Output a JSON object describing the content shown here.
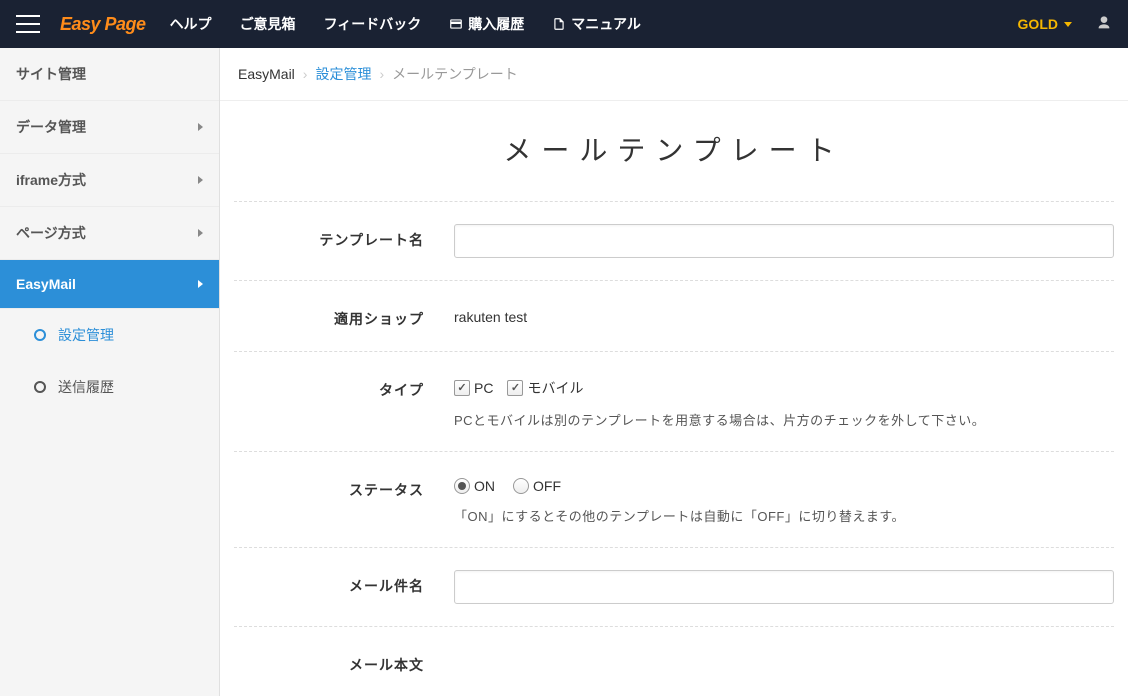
{
  "logo": "Easy Page",
  "topnav": {
    "help": "ヘルプ",
    "feedback_box": "ご意見箱",
    "feedback": "フィードバック",
    "purchase_history": "購入履歴",
    "manual": "マニュアル"
  },
  "account": {
    "label": "GOLD"
  },
  "sidebar": {
    "site_admin": "サイト管理",
    "data_admin": "データ管理",
    "iframe_mode": "iframe方式",
    "page_mode": "ページ方式",
    "easymail": "EasyMail",
    "submenu": {
      "settings": "設定管理",
      "send_history": "送信履歴"
    }
  },
  "breadcrumb": {
    "root": "EasyMail",
    "section": "設定管理",
    "current": "メールテンプレート"
  },
  "page_title": "メールテンプレート",
  "form": {
    "template_name": {
      "label": "テンプレート名",
      "value": ""
    },
    "shop": {
      "label": "適用ショップ",
      "value": "rakuten test"
    },
    "type": {
      "label": "タイプ",
      "pc": "PC",
      "mobile": "モバイル",
      "pc_checked": true,
      "mobile_checked": true,
      "help": "PCとモバイルは別のテンプレートを用意する場合は、片方のチェックを外して下さい。"
    },
    "status": {
      "label": "ステータス",
      "on": "ON",
      "off": "OFF",
      "selected": "on",
      "help": "「ON」にするとその他のテンプレートは自動に「OFF」に切り替えます。"
    },
    "subject": {
      "label": "メール件名",
      "value": ""
    },
    "body": {
      "label": "メール本文"
    }
  }
}
